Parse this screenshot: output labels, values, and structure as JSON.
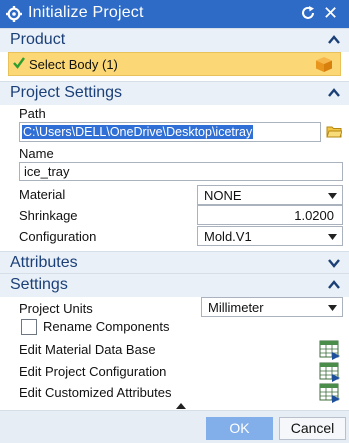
{
  "window": {
    "title": "Initialize Project"
  },
  "product": {
    "header": "Product",
    "select_body_label": "Select Body (1)"
  },
  "project_settings": {
    "header": "Project Settings",
    "path_label": "Path",
    "path_value": "C:\\Users\\DELL\\OneDrive\\Desktop\\icetray",
    "name_label": "Name",
    "name_value": "ice_tray",
    "material_label": "Material",
    "material_value": "NONE",
    "shrinkage_label": "Shrinkage",
    "shrinkage_value": "1.0200",
    "configuration_label": "Configuration",
    "configuration_value": "Mold.V1"
  },
  "attributes": {
    "header": "Attributes"
  },
  "settings": {
    "header": "Settings",
    "project_units_label": "Project Units",
    "project_units_value": "Millimeter",
    "rename_components_label": "Rename Components",
    "rename_components_checked": false,
    "edit_material_label": "Edit Material Data Base",
    "edit_project_config_label": "Edit Project Configuration",
    "edit_custom_attr_label": "Edit Customized Attributes"
  },
  "footer": {
    "ok_label": "OK",
    "cancel_label": "Cancel"
  },
  "colors": {
    "titlebar": "#2e6bc6",
    "section_header": "#e9f0f8",
    "selection_highlight": "#fbd775",
    "ok_button": "#82aeea"
  },
  "icons": {
    "title": "gear-icon",
    "reset": "reset-icon",
    "close": "close-icon",
    "select_ok": "check-icon",
    "select_body": "cube-icon",
    "browse": "folder-icon",
    "table_editor": "spreadsheet-icon"
  }
}
